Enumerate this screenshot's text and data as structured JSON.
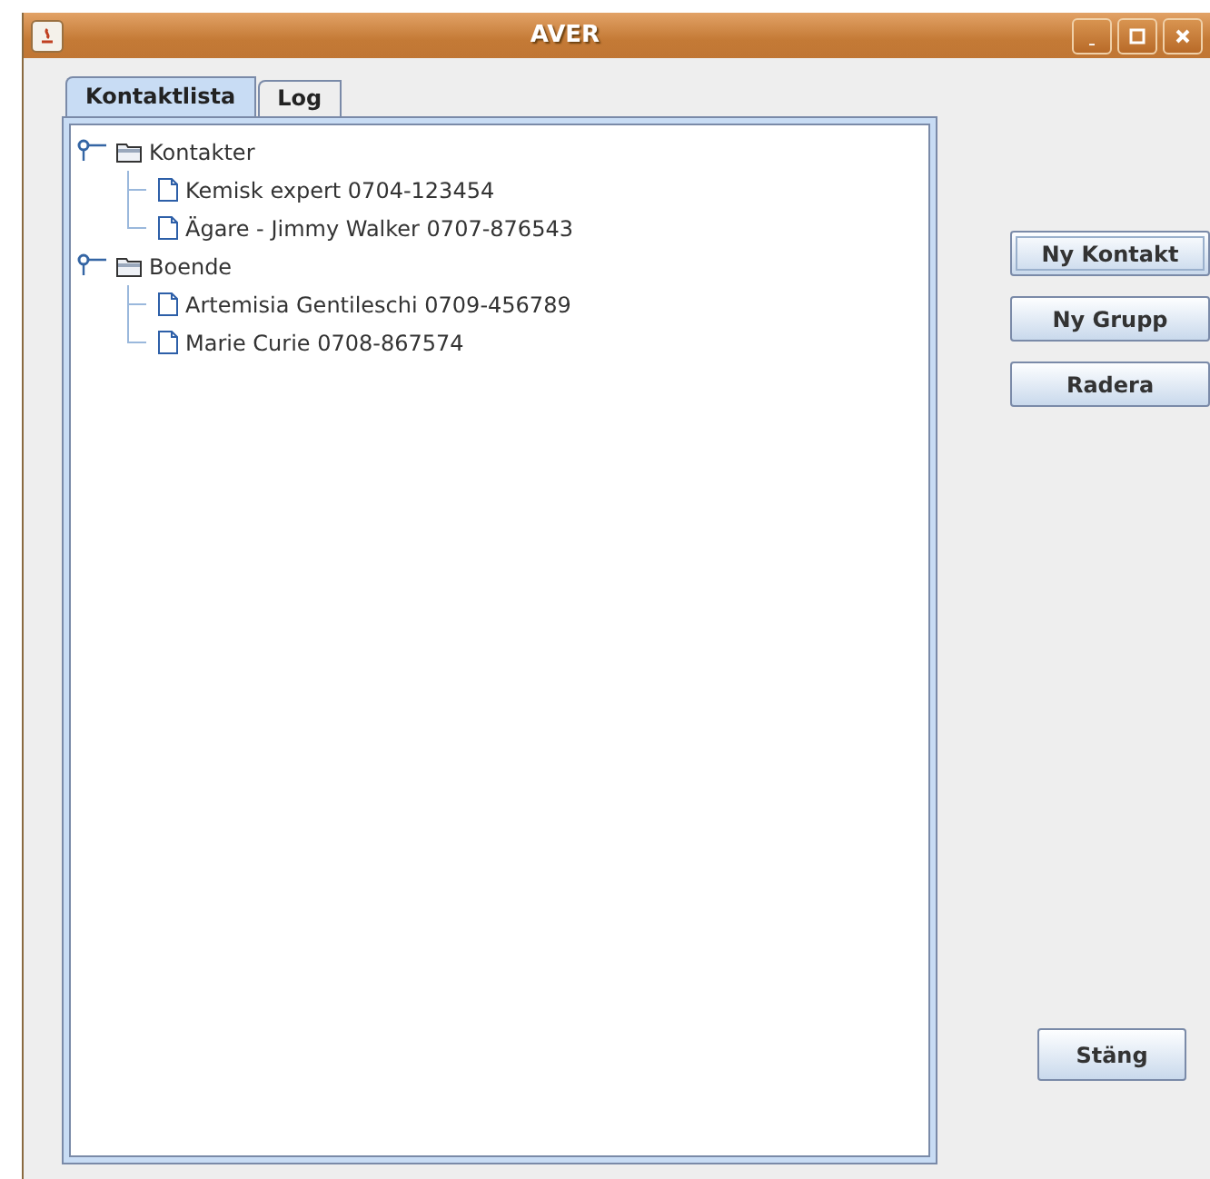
{
  "window": {
    "title": "AVER"
  },
  "tabs": [
    {
      "label": "Kontaktlista",
      "selected": true
    },
    {
      "label": "Log",
      "selected": false
    }
  ],
  "tree": [
    {
      "label": "Kontakter",
      "kind": "folder",
      "expanded": true,
      "children": [
        {
          "label": "Kemisk expert 0704-123454",
          "kind": "leaf"
        },
        {
          "label": "Ägare - Jimmy Walker 0707-876543",
          "kind": "leaf"
        }
      ]
    },
    {
      "label": "Boende",
      "kind": "folder",
      "expanded": true,
      "children": [
        {
          "label": "Artemisia Gentileschi 0709-456789",
          "kind": "leaf"
        },
        {
          "label": "Marie Curie 0708-867574",
          "kind": "leaf"
        }
      ]
    }
  ],
  "buttons": [
    {
      "label": "Ny Kontakt",
      "focused": true
    },
    {
      "label": "Ny Grupp",
      "focused": false
    },
    {
      "label": "Radera",
      "focused": false
    }
  ],
  "close_button": {
    "label": "Stäng"
  }
}
